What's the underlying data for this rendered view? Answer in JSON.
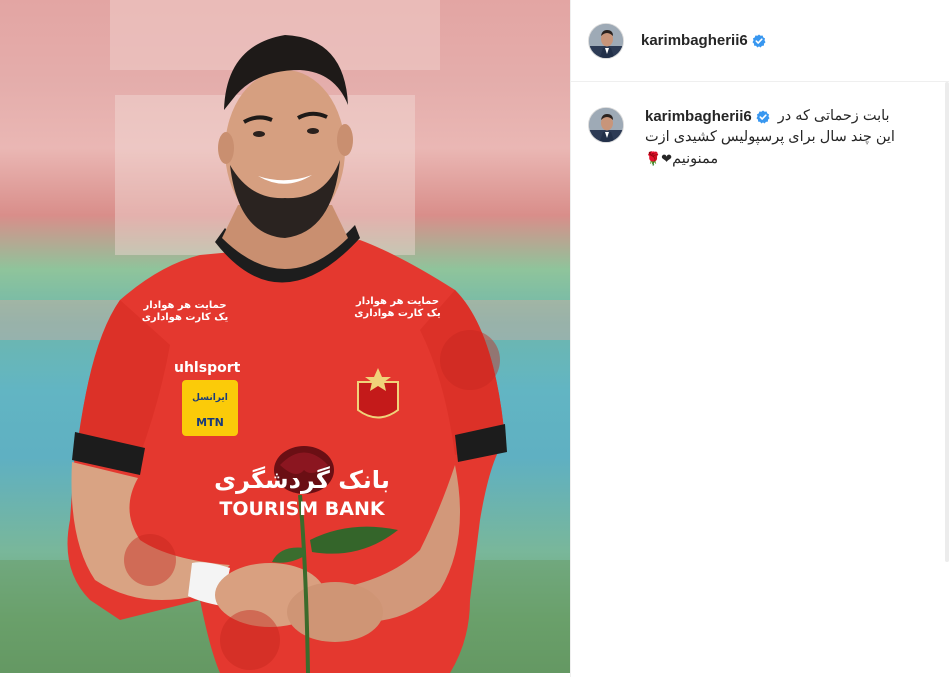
{
  "post": {
    "author": {
      "username": "karimbagherii6",
      "verified": true,
      "verified_color": "#3897f0"
    },
    "caption": {
      "line1": "بابت زحماتی که در",
      "line2": "این چند سال برای پرسپولیس کشیدی ازت",
      "line3_text": "ممنونیم",
      "line3_emoji": "❤🌹"
    },
    "media": {
      "subject": "player-in-red-jersey-holding-rose",
      "jersey_texts": {
        "brand": "uhlsport",
        "sponsor_badge_top": "ایرانسل",
        "sponsor_badge_bottom": "MTN",
        "main_sponsor_fa": "بانک گردشگری",
        "main_sponsor_en": "TOURISM BANK",
        "chest_left": "حمایت هر هوادار یک کارت هواداری",
        "chest_right": "حمایت هر هوادار یک کارت هواداری"
      }
    }
  }
}
